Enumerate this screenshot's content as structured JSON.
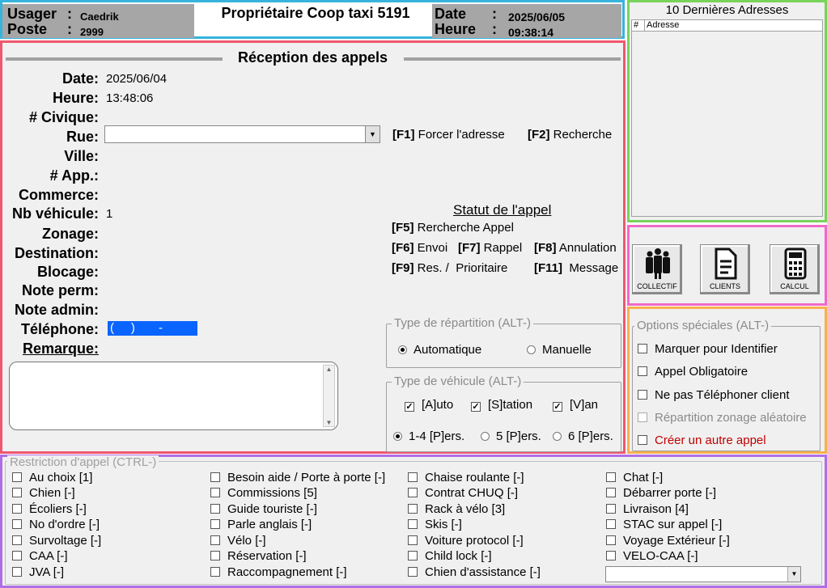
{
  "header": {
    "user_label": "Usager",
    "user_value": "Caedrik",
    "post_label": "Poste",
    "post_value": "2999",
    "colon": ":",
    "title": "Propriétaire Coop taxi 5191",
    "date_label": "Date",
    "date_value": "2025/06/05",
    "time_label": "Heure",
    "time_value": "09:38:14"
  },
  "recent": {
    "title": "10 Dernières Adresses",
    "col_num": "#",
    "col_address": "Adresse"
  },
  "reception": {
    "title": "Réception des appels",
    "fields": {
      "date_label": "Date:",
      "date_value": "2025/06/04",
      "time_label": "Heure:",
      "time_value": "13:48:06",
      "civic_label": "# Civique:",
      "street_label": "Rue:",
      "city_label": "Ville:",
      "apt_label": "# App.:",
      "business_label": "Commerce:",
      "vehicles_label": "Nb véhicule:",
      "vehicles_value": "1",
      "zoning_label": "Zonage:",
      "destination_label": "Destination:",
      "blocking_label": "Blocage:",
      "note_perm_label": "Note perm:",
      "note_admin_label": "Note admin:",
      "phone_label": "Téléphone:",
      "phone_value": "(     )       -",
      "remark_label": "Remarque:"
    },
    "fkeys": {
      "f1_key": "[F1]",
      "f1_label": "Forcer l'adresse",
      "f2_key": "[F2]",
      "f2_label": "Recherche",
      "status_title": "Statut de l'appel",
      "f5_key": "[F5]",
      "f5_label": "Rercherche Appel",
      "f6_key": "[F6]",
      "f6_label": "Envoi",
      "f7_key": "[F7]",
      "f7_label": "Rappel",
      "f8_key": "[F8]",
      "f8_label": "Annulation",
      "f9_key": "[F9]",
      "f9_label": "Res. /",
      "f9_label2": "Prioritaire",
      "f11_key": "[F11]",
      "f11_label": "Message"
    },
    "dispatch": {
      "title": "Type de répartition (ALT-)",
      "auto": "Automatique",
      "manual": "Manuelle"
    },
    "vehicle": {
      "title": "Type de véhicule (ALT-)",
      "auto": "[A]uto",
      "station": "[S]tation",
      "van": "[V]an",
      "p14": "1-4 [P]ers.",
      "p5": "5 [P]ers.",
      "p6": "6 [P]ers."
    }
  },
  "buttons": {
    "collectif": "COLLECTIF",
    "clients": "CLIENTS",
    "calcul": "CALCUL"
  },
  "options": {
    "title": "Options spéciales (ALT-)",
    "items": [
      "Marquer pour Identifier",
      "Appel Obligatoire",
      "Ne pas Téléphoner client",
      "Répartition zonage aléatoire",
      "Créer un autre appel"
    ]
  },
  "restrictions": {
    "title": "Restriction d'appel (CTRL-)",
    "col1": [
      "Au choix [1]",
      "Chien [-]",
      "Écoliers [-]",
      "No d'ordre [-]",
      "Survoltage [-]",
      "CAA [-]",
      "JVA [-]"
    ],
    "col2": [
      "Besoin aide / Porte à porte [-]",
      "Commissions [5]",
      "Guide touriste [-]",
      "Parle anglais [-]",
      "Vélo [-]",
      "Réservation [-]",
      "Raccompagnement [-]"
    ],
    "col3": [
      "Chaise roulante [-]",
      "Contrat CHUQ [-]",
      "Rack à vélo [3]",
      "Skis [-]",
      "Voiture protocol [-]",
      "Child lock [-]",
      "Chien d'assistance [-]"
    ],
    "col4": [
      "Chat [-]",
      "Débarrer porte [-]",
      "Livraison [4]",
      "STAC sur appel [-]",
      "Voyage Extérieur [-]",
      "VELO-CAA [-]"
    ]
  },
  "colors": {
    "header_border": "#36b4dc",
    "recent_border": "#78d35a",
    "main_border": "#f0566e",
    "buttons_border": "#f069c8",
    "options_border": "#f7b14e",
    "restrictions_border": "#b06ee6",
    "phone_highlight": "#0a64ff",
    "create_call": "#c00000"
  }
}
